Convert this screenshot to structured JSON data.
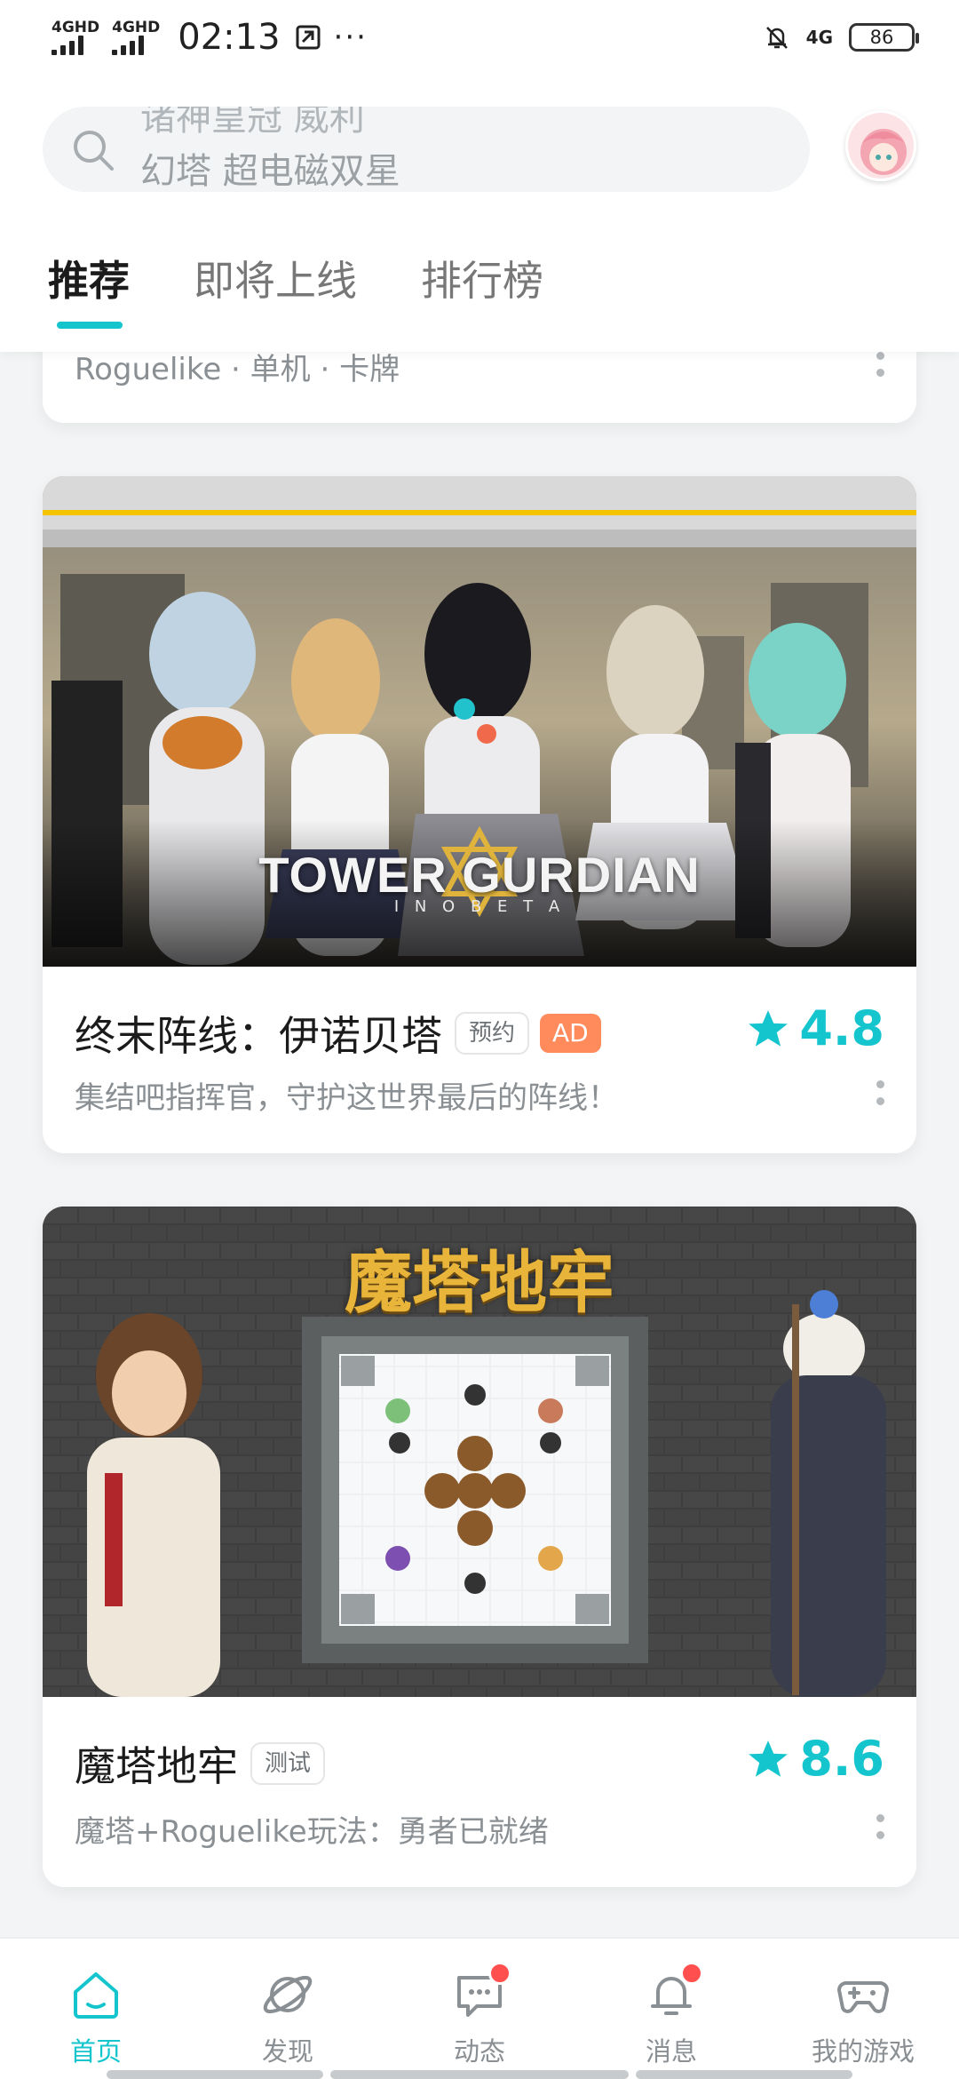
{
  "status_bar": {
    "net1": "4GHD",
    "net2": "4GHD",
    "time": "02:13",
    "more": "···",
    "net_right": "4G",
    "battery": "86"
  },
  "search": {
    "prev_text": "诸神皇冠 威利",
    "placeholder": "幻塔 超电磁双星"
  },
  "tabs": [
    {
      "label": "推荐"
    },
    {
      "label": "即将上线"
    },
    {
      "label": "排行榜"
    }
  ],
  "partial_card": {
    "tags": "Roguelike · 单机 · 卡牌"
  },
  "cards": [
    {
      "banner_title": "TOWER GURDIAN",
      "banner_sub": "I N O B E T A",
      "title": "终末阵线：伊诺贝塔",
      "badge": "预约",
      "ad": "AD",
      "rating": "4.8",
      "desc": "集结吧指挥官，守护这世界最后的阵线！"
    },
    {
      "banner_title": "魔塔地牢",
      "title": "魔塔地牢",
      "badge": "测试",
      "rating": "8.6",
      "desc": "魔塔+Roguelike玩法：勇者已就绪"
    }
  ],
  "bottom_nav": [
    {
      "label": "首页",
      "icon": "home-icon"
    },
    {
      "label": "发现",
      "icon": "planet-icon"
    },
    {
      "label": "动态",
      "icon": "chat-icon"
    },
    {
      "label": "消息",
      "icon": "bell-icon"
    },
    {
      "label": "我的游戏",
      "icon": "gamepad-icon"
    }
  ],
  "colors": {
    "accent": "#15c5ce",
    "ad": "#ff8a5c",
    "badge_dot": "#ff4f4f"
  }
}
